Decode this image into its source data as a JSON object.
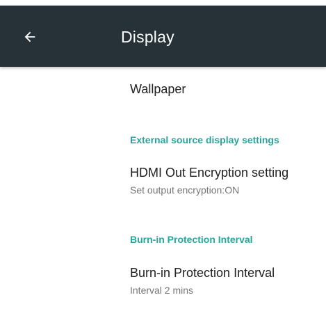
{
  "app_bar": {
    "title": "Display",
    "background": "#263238",
    "back_icon": "arrow-back-icon"
  },
  "items": {
    "wallpaper": {
      "title": "Wallpaper"
    },
    "category_external": {
      "label": "External source display settings"
    },
    "hdmi": {
      "title": "HDMI Out Encryption setting",
      "summary": "Set output encryption:ON"
    },
    "category_burnin": {
      "label": "Burn-in Protection Interval"
    },
    "burnin": {
      "title": "Burn-in Protection Interval",
      "summary": "Interval 2 mins"
    }
  },
  "colors": {
    "accent": "#26a69a",
    "primary_text": "#212121",
    "secondary_text": "#757575"
  }
}
